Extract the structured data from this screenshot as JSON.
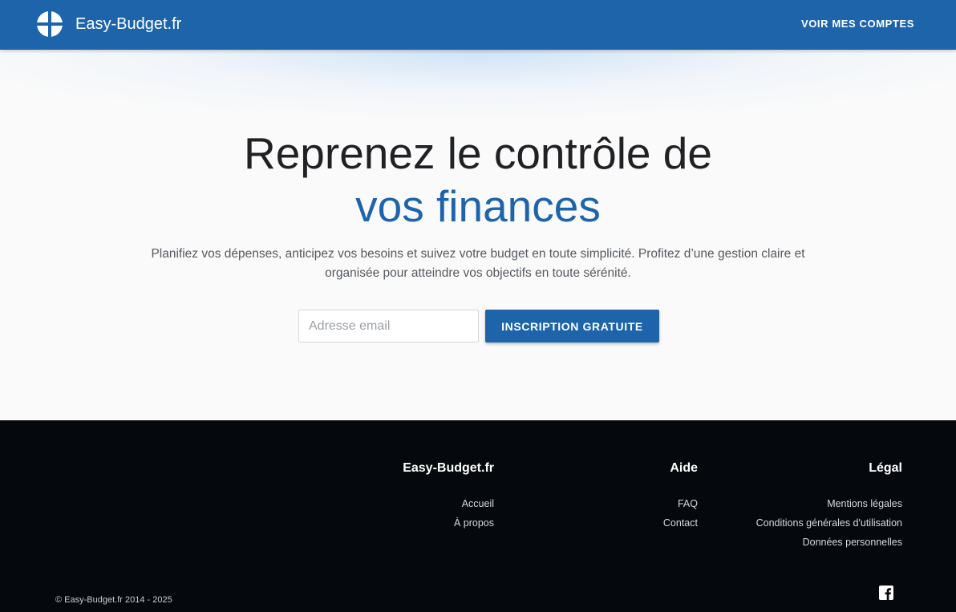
{
  "header": {
    "brand_name": "Easy-Budget.fr",
    "logo_icon": "pie-quarters-logo-icon",
    "nav_accounts": "VOIR MES COMPTES"
  },
  "hero": {
    "title_line1": "Reprenez le contrôle de",
    "title_line2": "vos finances",
    "subtitle": "Planifiez vos dépenses, anticipez vos besoins et suivez votre budget en toute simplicité. Profitez d’une gestion claire et organisée pour atteindre vos objectifs en toute sérénité.",
    "email_placeholder": "Adresse email",
    "email_value": "",
    "signup_label": "INSCRIPTION GRATUITE"
  },
  "footer": {
    "columns": [
      {
        "title": "Easy-Budget.fr",
        "links": [
          "Accueil",
          "À propos"
        ]
      },
      {
        "title": "Aide",
        "links": [
          "FAQ",
          "Contact"
        ]
      },
      {
        "title": "Légal",
        "links": [
          "Mentions légales",
          "Conditions générales d'utilisation",
          "Données personnelles"
        ]
      }
    ],
    "copyright": "© Easy-Budget.fr 2014 - 2025",
    "social_icon": "facebook-icon"
  },
  "colors": {
    "primary": "#1d64ab",
    "footer_bg": "#05080c",
    "hero_bg": "#fafafa",
    "title_text": "#202124"
  }
}
